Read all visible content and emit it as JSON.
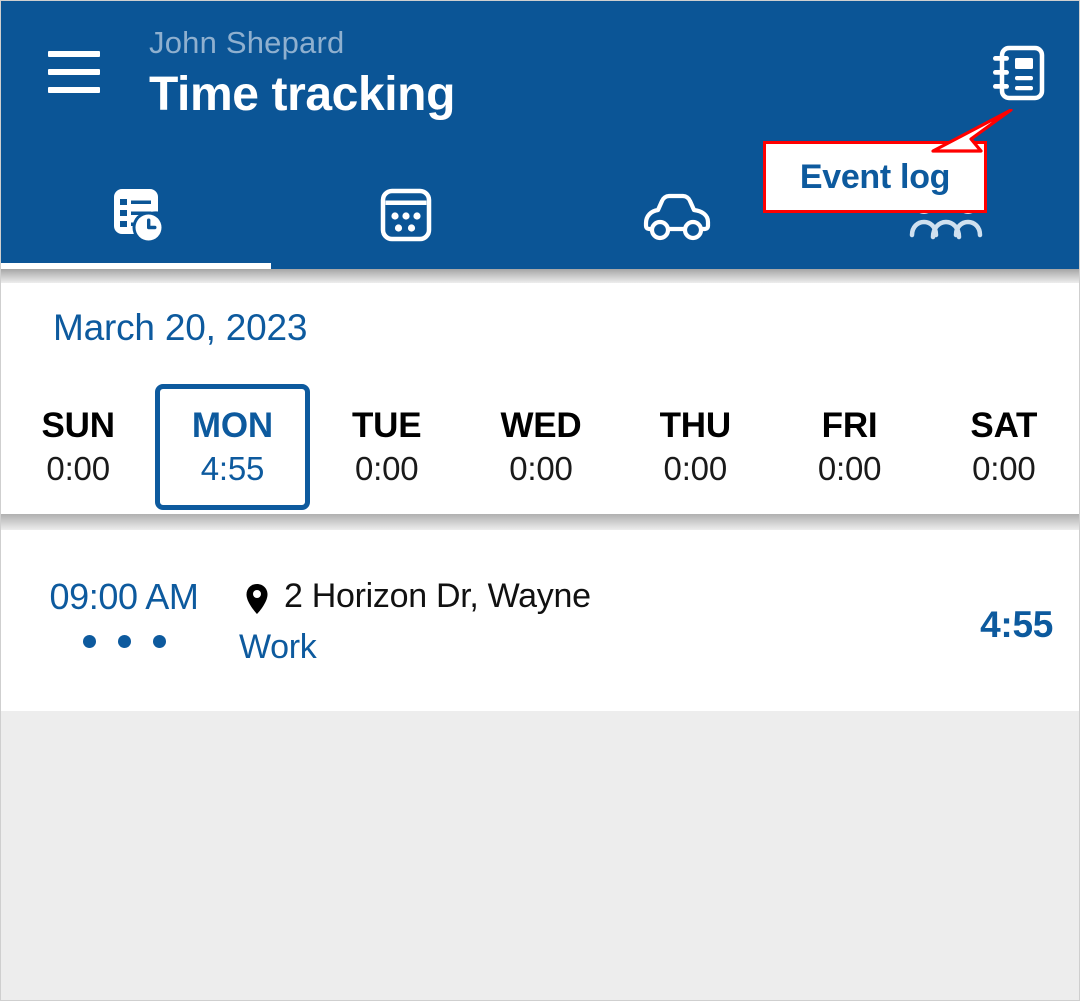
{
  "theme": {
    "header_blue": "#0b5596",
    "accent_blue": "#0d5a9e",
    "subtitle_blue": "#8fb0cf",
    "callout_red": "#ff0000",
    "page_grey": "#ededed",
    "card_white": "#ffffff"
  },
  "header": {
    "menu_icon": "hamburger-menu-icon",
    "subtitle": "John Shepard",
    "title": "Time tracking",
    "event_log_icon": "event-log-notebook-icon"
  },
  "callout": {
    "label": "Event log",
    "border_color": "#ff0000",
    "text_color": "#0d5a9e"
  },
  "tabs": [
    {
      "name": "timesheet",
      "icon": "document-clock-icon",
      "active": true
    },
    {
      "name": "calendar",
      "icon": "calendar-icon",
      "active": false
    },
    {
      "name": "mileage",
      "icon": "car-icon",
      "active": false
    },
    {
      "name": "people",
      "icon": "people-group-icon",
      "active": false
    }
  ],
  "week": {
    "date_label": "March 20, 2023",
    "days": [
      {
        "name": "SUN",
        "hours": "0:00",
        "selected": false
      },
      {
        "name": "MON",
        "hours": "4:55",
        "selected": true
      },
      {
        "name": "TUE",
        "hours": "0:00",
        "selected": false
      },
      {
        "name": "WED",
        "hours": "0:00",
        "selected": false
      },
      {
        "name": "THU",
        "hours": "0:00",
        "selected": false
      },
      {
        "name": "FRI",
        "hours": "0:00",
        "selected": false
      },
      {
        "name": "SAT",
        "hours": "0:00",
        "selected": false
      }
    ]
  },
  "entries": [
    {
      "time": "09:00 AM",
      "more_indicator": "three-dots",
      "location_icon": "map-pin-icon",
      "location": "2 Horizon Dr, Wayne",
      "project": "Work",
      "duration": "4:55"
    }
  ]
}
